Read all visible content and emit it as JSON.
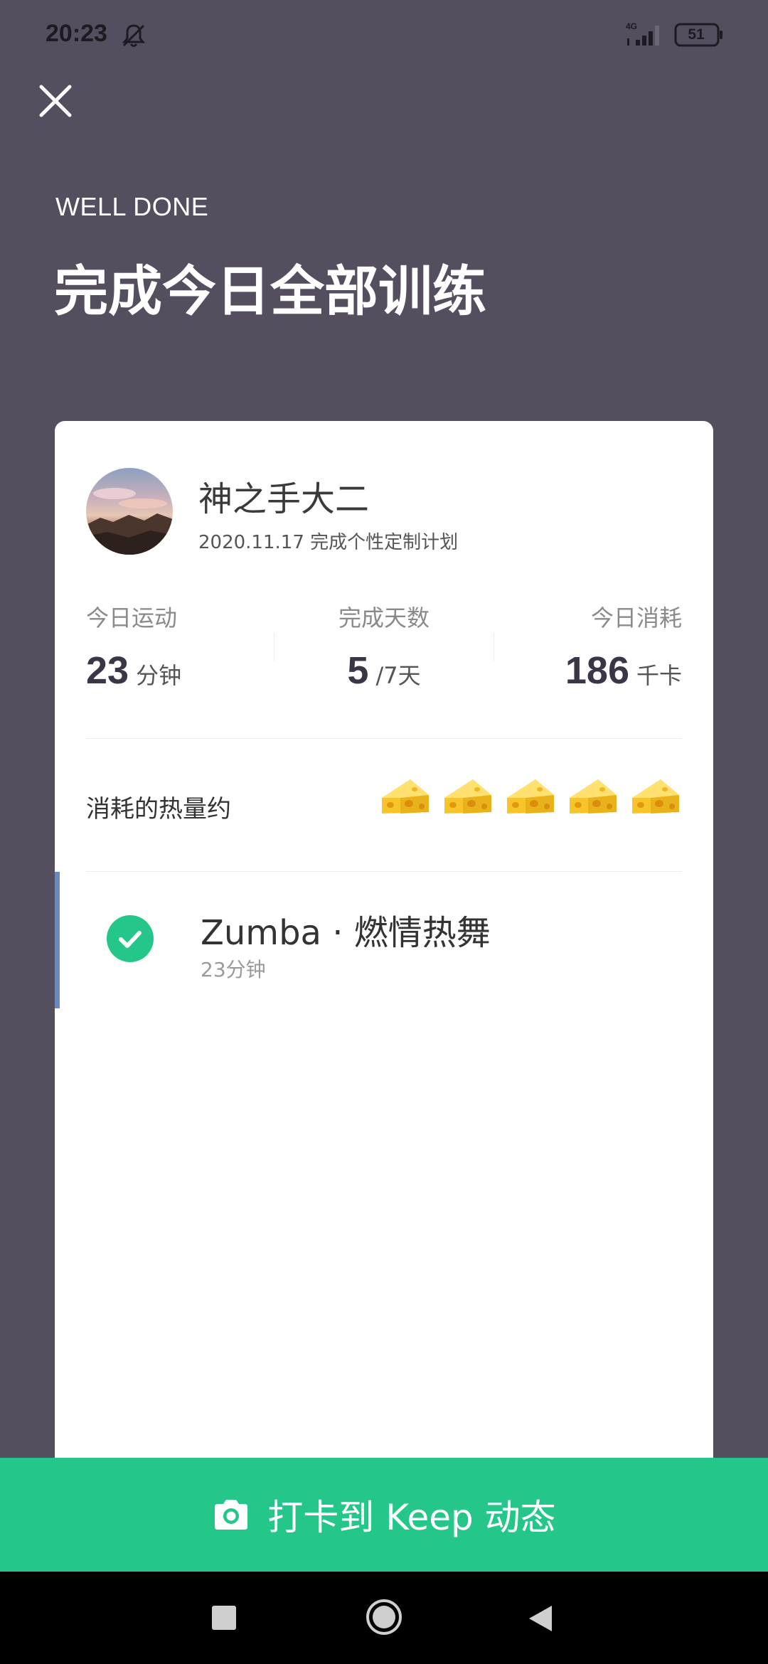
{
  "status_bar": {
    "time": "20:23",
    "network": "4G",
    "battery": "51"
  },
  "header": {
    "eyebrow": "WELL DONE",
    "title": "完成今日全部训练"
  },
  "user": {
    "name": "神之手大二",
    "subtitle": "2020.11.17 完成个性定制计划"
  },
  "stats": [
    {
      "label": "今日运动",
      "value": "23",
      "unit": "分钟"
    },
    {
      "label": "完成天数",
      "value": "5",
      "unit": "/7天"
    },
    {
      "label": "今日消耗",
      "value": "186",
      "unit": "千卡"
    }
  ],
  "calories_equivalent": {
    "label": "消耗的热量约",
    "icon": "cheese-icon",
    "count": 5
  },
  "workout": {
    "title": "Zumba · 燃情热舞",
    "duration": "23分钟",
    "completed": true
  },
  "checkin_button": {
    "label": "打卡到 Keep 动态",
    "icon": "camera-icon"
  },
  "colors": {
    "background": "#554e5f",
    "accent_green": "#24c789",
    "active_bar": "#6a89c4"
  }
}
